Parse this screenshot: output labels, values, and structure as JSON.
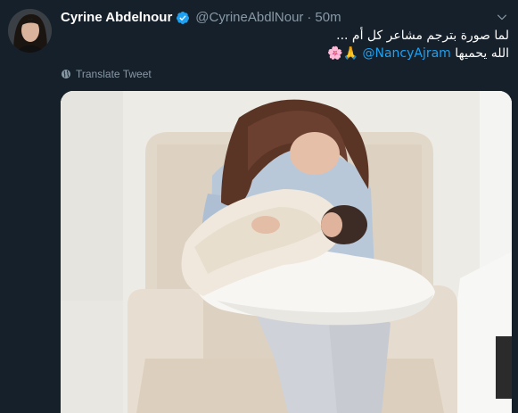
{
  "tweet": {
    "author_name": "Cyrine Abdelnour",
    "author_handle": "@CyrineAbdlNour",
    "separator": "·",
    "time": "50m",
    "text_line1": "لما صورة بترجم مشاعر كل أم ...",
    "text_line2_prefix": "الله يحميها",
    "mention": "@NancyAjram",
    "emojis": "🙏🌸",
    "translate_label": "Translate Tweet"
  },
  "icons": {
    "verified": "verified-badge-icon",
    "globe": "globe-icon",
    "chevron": "chevron-down-icon"
  },
  "colors": {
    "background": "#15202b",
    "secondary_text": "#8899a6",
    "link": "#1da1f2",
    "verified": "#1da1f2"
  }
}
